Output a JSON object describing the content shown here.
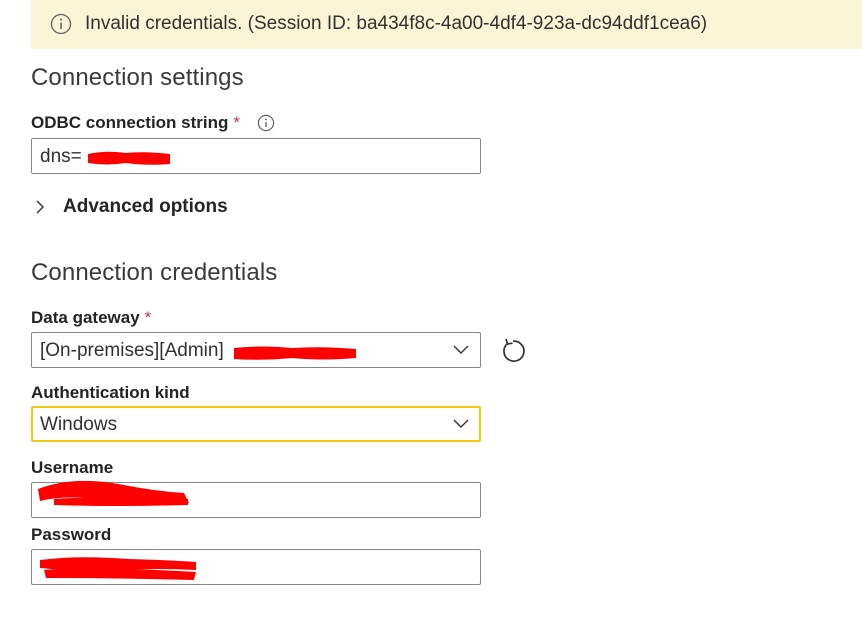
{
  "banner": {
    "message": "Invalid credentials. (Session ID: ba434f8c-4a00-4df4-923a-dc94ddf1cea6)",
    "icon": "info-icon"
  },
  "connection_settings": {
    "title": "Connection settings",
    "odbc_label": "ODBC connection string",
    "odbc_required": "*",
    "odbc_info_icon": "info-icon",
    "odbc_value": "dns=",
    "advanced_label": "Advanced options"
  },
  "connection_credentials": {
    "title": "Connection credentials",
    "gateway_label": "Data gateway",
    "gateway_required": "*",
    "gateway_value": "[On-premises][Admin]",
    "auth_label": "Authentication kind",
    "auth_value": "Windows",
    "username_label": "Username",
    "password_label": "Password"
  },
  "colors": {
    "banner_bg": "#fcf4d6",
    "focus_border": "#f2c811",
    "required": "#c4314b",
    "redaction": "#ff0000"
  }
}
